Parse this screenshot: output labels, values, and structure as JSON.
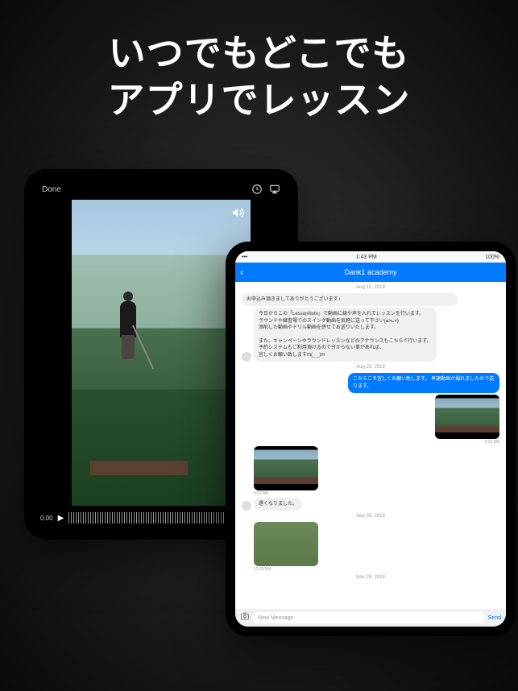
{
  "headline": {
    "line1": "いつでもどこでも",
    "line2": "アプリでレッスン"
  },
  "video_player": {
    "done_label": "Done",
    "timecode": "0:00"
  },
  "chat": {
    "status_time": "1:43 PM",
    "status_battery": "100%",
    "header_title": "Dank1 academy",
    "dates": [
      "Aug 15, 2019",
      "Aug 25, 2019",
      "Sep 26, 2019",
      "Nov 26, 2019"
    ],
    "messages": {
      "m1a": "お申込み頂きましてありがとうございます♪",
      "m1b": "今日からこの「LessonNote」で動画に線や声を入れてレッスンを行います。\nラウンドや練習場でのスイング動画を気軽に送って下さい(๑˃̵ᴗ˂̵)\n添削した動画やドリル動画を併せてお送りいたします。\n\nまた、キャンペーンやラウンドレッスンなどのアナウンスもこちらで行います。\n予約システムもご利用頂けるので分からない事があれば、\n宜しくお願い致しますm(_ _)m",
      "m2": "こちらこそ宜しくお願い致します。\n早速動画が撮れましたので送ります。",
      "m3": "遅くなりました。",
      "t1": "9:22 AM",
      "t2": "9:22 AM",
      "t3": "12:23 PM"
    },
    "input_placeholder": "New Message",
    "send_label": "Send"
  }
}
